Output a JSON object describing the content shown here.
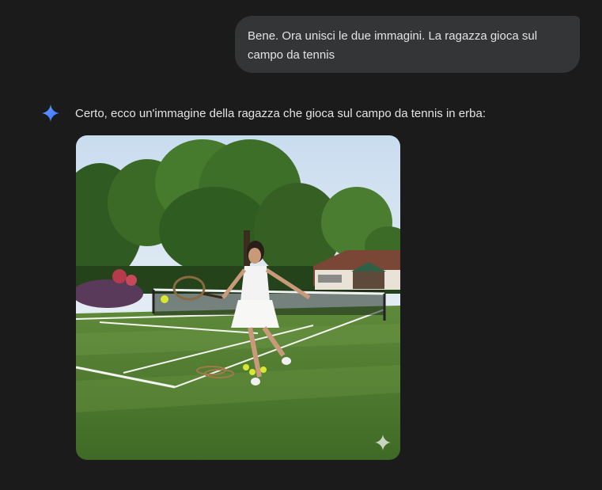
{
  "conversation": {
    "user_message": {
      "text": "Bene. Ora unisci le due immagini. La ragazza gioca sul campo da tennis"
    },
    "assistant_message": {
      "icon": "gemini-sparkle-icon",
      "text": "Certo, ecco un'immagine della ragazza che gioca sul campo da tennis in erba:",
      "image": {
        "badge_icon": "sparkle-watermark-icon"
      }
    }
  },
  "colors": {
    "background": "#1b1b1b",
    "user_bubble": "#333537",
    "text": "#e3e3e3",
    "accent": "#4a8bff"
  }
}
